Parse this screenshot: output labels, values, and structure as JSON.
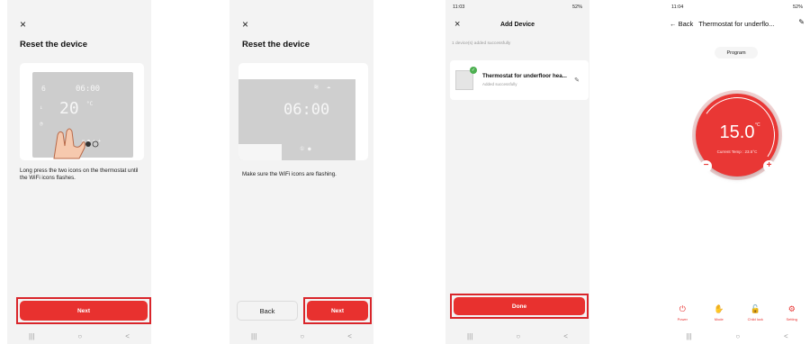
{
  "screen1": {
    "close_icon": "×",
    "title": "Reset the device",
    "lcd": {
      "s": "6",
      "time": "06:00",
      "temp": "20",
      "unit": "°C"
    },
    "caption": "Long press the two icons on the thermostat until the WiFi icons flashes.",
    "next_label": "Next",
    "nav": [
      "|||",
      "○",
      "<"
    ]
  },
  "screen2": {
    "close_icon": "×",
    "title": "Reset the device",
    "lcd": {
      "time": "06:00",
      "wifi": "≋"
    },
    "caption": "Make sure the WiFi icons are flashing.",
    "back_label": "Back",
    "next_label": "Next",
    "nav": [
      "|||",
      "○",
      "<"
    ]
  },
  "screen3": {
    "status": {
      "time": "11:03",
      "battery": "52%"
    },
    "close_icon": "×",
    "title": "Add Device",
    "note": "1 device(s) added successfully",
    "device": {
      "name": "Thermostat for underfloor hea...",
      "status": "Added successfully"
    },
    "done_label": "Done",
    "nav": [
      "|||",
      "○",
      "<"
    ]
  },
  "screen4": {
    "status": {
      "time": "11:04",
      "battery": "52%"
    },
    "back_label": "← Back",
    "title": "Thermostat for underflo...",
    "program_label": "Program",
    "temp": "15.0",
    "unit": "°C",
    "current": "Current Temp : 23.5°C",
    "minus": "−",
    "plus": "+",
    "controls": [
      {
        "icon": "⏻",
        "label": "Power"
      },
      {
        "icon": "✋",
        "label": "Mode"
      },
      {
        "icon": "🔓",
        "label": "Child lock"
      },
      {
        "icon": "⚙",
        "label": "Setting"
      }
    ],
    "nav": [
      "|||",
      "○",
      "<"
    ]
  },
  "colors": {
    "accent": "#e8312f",
    "frame": "#d9252a"
  }
}
